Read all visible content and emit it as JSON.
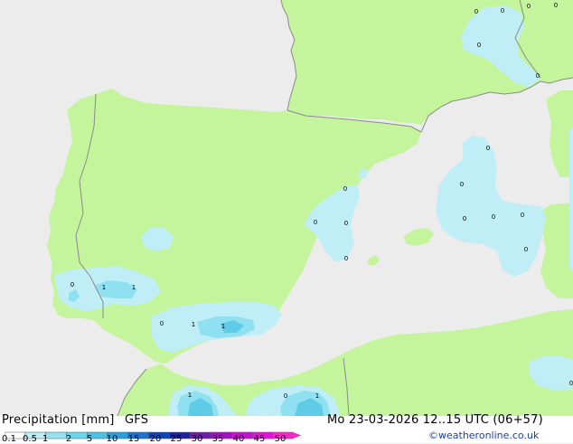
{
  "product": {
    "title": "Precipitation [mm]",
    "model": "GFS",
    "datetime": "Mo 23-03-2026 12..15 UTC (06+57)",
    "credit": "©weatheronline.co.uk"
  },
  "legend": {
    "ticks": [
      "0.1",
      "0.5",
      "1",
      "2",
      "5",
      "10",
      "15",
      "20",
      "25",
      "30",
      "35",
      "40",
      "45",
      "50"
    ],
    "colors": [
      "#ffffff",
      "#bfeef7",
      "#96e1f0",
      "#6ed4ea",
      "#4bc4e3",
      "#2c9fd9",
      "#1b73cc",
      "#0f45b8",
      "#1d1f9b",
      "#6d1ea7",
      "#a011c4",
      "#c40fd2",
      "#e311d9",
      "#f22ac7"
    ]
  },
  "map": {
    "colors": {
      "sea": "#ececec",
      "land_dry": "#c4f59d",
      "precip_light": "#bfeef7",
      "precip_mid": "#8fe0f0",
      "precip_heavy": "#5ecce6",
      "border": "#8a8a8a"
    },
    "point_values": [
      {
        "v": "0"
      },
      {
        "v": "0"
      },
      {
        "v": "0"
      },
      {
        "v": "0"
      },
      {
        "v": "0"
      },
      {
        "v": "0"
      },
      {
        "v": "0"
      },
      {
        "v": "0"
      },
      {
        "v": "0"
      },
      {
        "v": "0"
      },
      {
        "v": "0"
      },
      {
        "v": "0"
      },
      {
        "v": "0"
      },
      {
        "v": "0"
      },
      {
        "v": "0"
      },
      {
        "v": "0"
      },
      {
        "v": "1"
      },
      {
        "v": "1"
      },
      {
        "v": "0"
      },
      {
        "v": "1"
      },
      {
        "v": "1"
      },
      {
        "v": "0"
      },
      {
        "v": "1"
      },
      {
        "v": "0"
      },
      {
        "v": "1"
      },
      {
        "v": "0"
      }
    ]
  }
}
